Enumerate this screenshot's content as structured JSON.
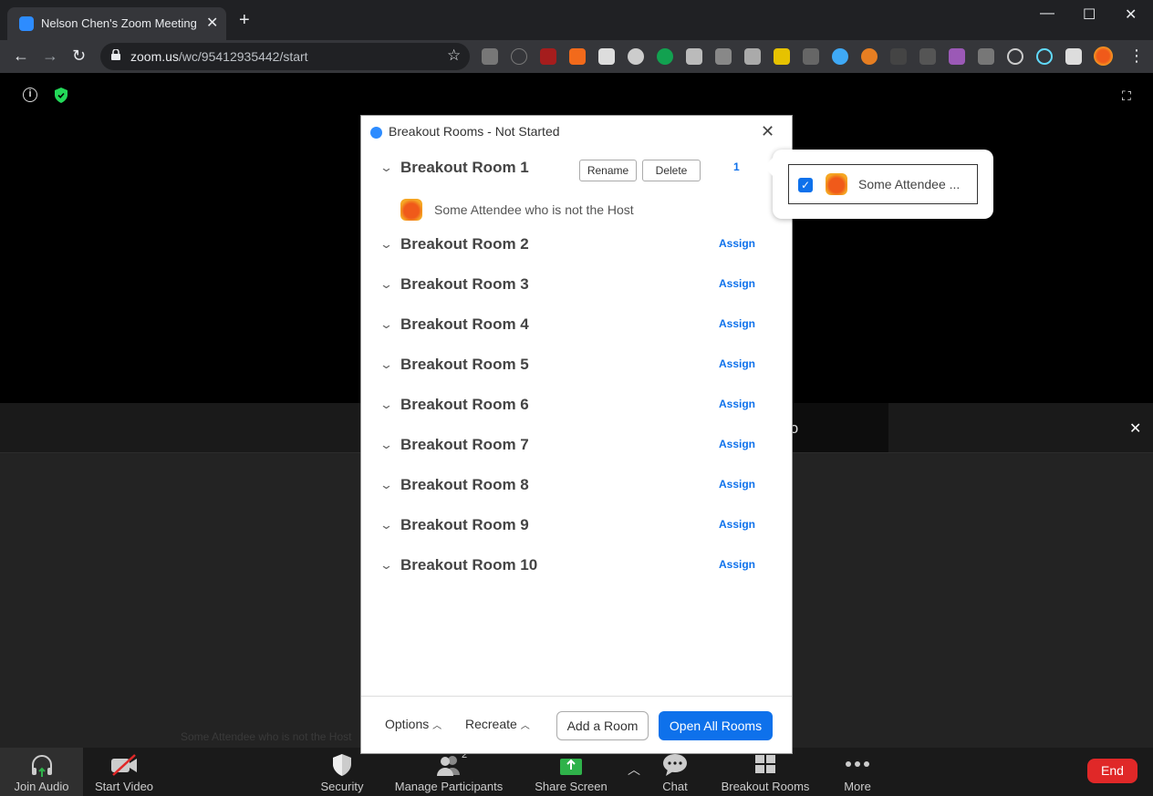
{
  "browser": {
    "tab_title": "Nelson Chen's Zoom Meeting",
    "new_tab_glyph": "+",
    "url_host": "zoom.us",
    "url_path": "/wc/95412935442/start"
  },
  "meeting": {
    "audio_banner_text": "io",
    "ghost_text": "Some Attendee who is not the Host"
  },
  "dialog": {
    "title": "Breakout Rooms - Not Started",
    "rename_label": "Rename",
    "delete_label": "Delete",
    "assign_label": "Assign",
    "rooms": [
      {
        "name": "Breakout Room 1",
        "count": "1"
      },
      {
        "name": "Breakout Room 2"
      },
      {
        "name": "Breakout Room 3"
      },
      {
        "name": "Breakout Room 4"
      },
      {
        "name": "Breakout Room 5"
      },
      {
        "name": "Breakout Room 6"
      },
      {
        "name": "Breakout Room 7"
      },
      {
        "name": "Breakout Room 8"
      },
      {
        "name": "Breakout Room 9"
      },
      {
        "name": "Breakout Room 10"
      }
    ],
    "attendee": "Some Attendee who is not the Host",
    "footer": {
      "options": "Options",
      "recreate": "Recreate",
      "add_room": "Add a Room",
      "open_all": "Open All Rooms"
    }
  },
  "popover": {
    "attendee_short": "Some Attendee ...",
    "checked": true
  },
  "bottom_bar": {
    "join_audio": "Join Audio",
    "start_video": "Start Video",
    "security": "Security",
    "manage_participants": "Manage Participants",
    "participant_count": "2",
    "share_screen": "Share Screen",
    "chat": "Chat",
    "breakout_rooms": "Breakout Rooms",
    "more": "More",
    "end": "End"
  },
  "colors": {
    "accent": "#0e71eb",
    "end": "#e02828",
    "share": "#2fb24a"
  }
}
